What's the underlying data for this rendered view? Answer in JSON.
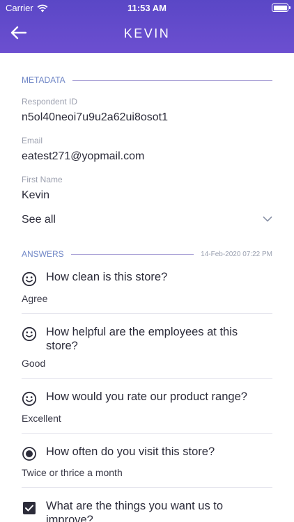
{
  "status_bar": {
    "carrier": "Carrier",
    "time": "11:53 AM"
  },
  "header": {
    "title": "KEVIN",
    "back_icon": "arrow-left-icon"
  },
  "metadata": {
    "section_label": "METADATA",
    "fields": [
      {
        "label": "Respondent ID",
        "value": "n5ol40neoi7u9u2a62ui8osot1"
      },
      {
        "label": "Email",
        "value": "eatest271@yopmail.com"
      },
      {
        "label": "First Name",
        "value": "Kevin"
      }
    ],
    "see_all_label": "See all"
  },
  "answers": {
    "section_label": "ANSWERS",
    "date": "14-Feb-2020 07:22 PM",
    "items": [
      {
        "question": "How clean is this store?",
        "answer": "Agree",
        "icon": "smiley-icon"
      },
      {
        "question": "How helpful are the employees at this store?",
        "answer": "Good",
        "icon": "smiley-icon"
      },
      {
        "question": "How would you rate our product range?",
        "answer": "Excellent",
        "icon": "smiley-icon"
      },
      {
        "question": "How often do you visit this store?",
        "answer": "Twice or thrice a month",
        "icon": "radio-icon"
      },
      {
        "question": "What are the things you want us to improve?",
        "answer": "",
        "icon": "checkbox-icon"
      }
    ]
  },
  "colors": {
    "header_start": "#5a47c6",
    "header_end": "#6c4fd0",
    "section_label": "#6f86c6"
  }
}
